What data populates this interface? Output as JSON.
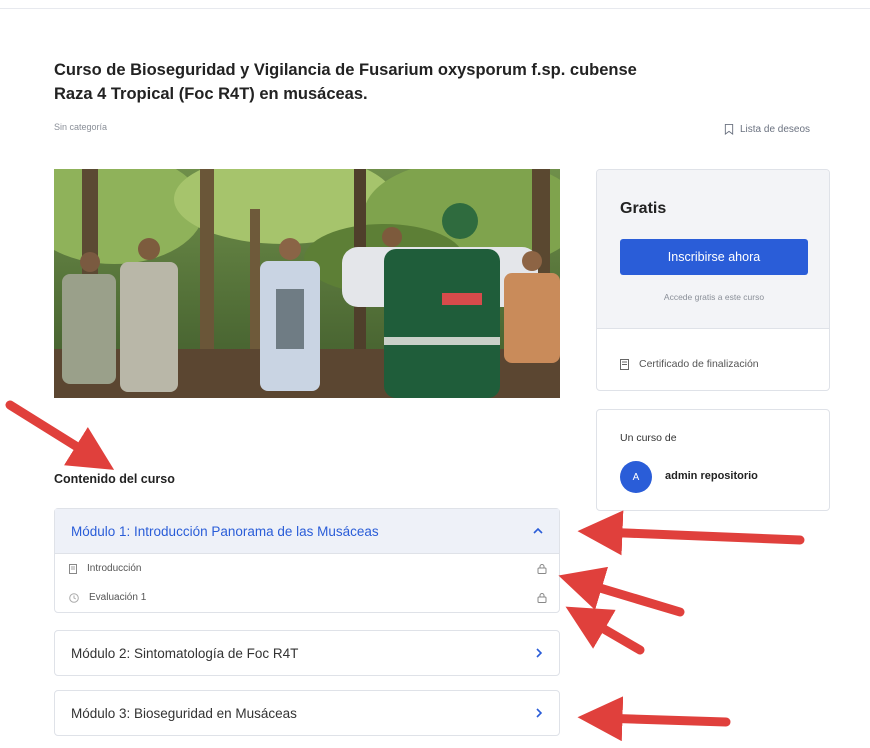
{
  "course": {
    "title": "Curso de Bioseguridad y Vigilancia de Fusarium oxysporum f.sp. cubense Raza 4 Tropical (Foc R4T) en musáceas.",
    "category": "Sin categoría",
    "wishlist_label": "Lista de deseos",
    "photo_alt": "bookmark-icon"
  },
  "pricing": {
    "price": "Gratis",
    "enroll_label": "Inscribirse ahora",
    "free_note": "Accede gratis a este curso",
    "certificate_label": "Certificado de finalización"
  },
  "instructor": {
    "by_label": "Un curso de",
    "avatar_initial": "A",
    "name": "admin repositorio"
  },
  "content": {
    "section_title": "Contenido del curso",
    "modules": [
      {
        "label": "Módulo 1: Introducción Panorama de las Musáceas",
        "lessons": [
          {
            "label": "Introducción",
            "icon": "document-icon"
          },
          {
            "label": "Evaluación 1",
            "icon": "clock-icon"
          }
        ]
      },
      {
        "label": "Módulo 2: Sintomatología de Foc R4T"
      },
      {
        "label": "Módulo 3: Bioseguridad en Musáceas"
      }
    ]
  },
  "colors": {
    "accent": "#2a5dd8",
    "annotation_arrow": "#e0403c"
  }
}
